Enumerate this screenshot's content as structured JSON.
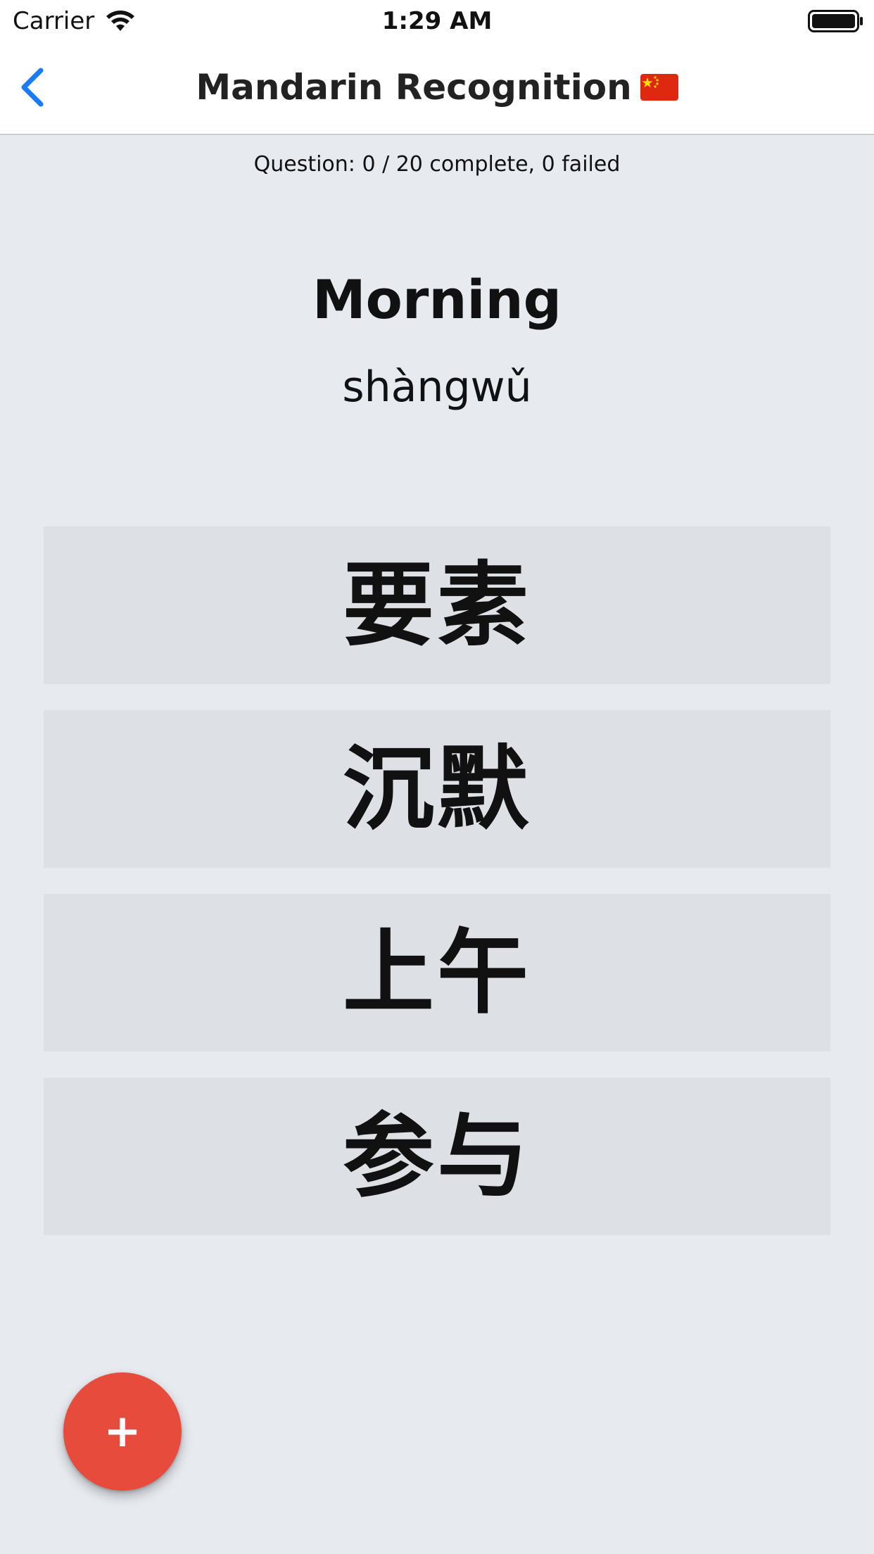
{
  "status_bar": {
    "carrier": "Carrier",
    "time": "1:29 AM",
    "wifi_icon": "wifi-icon",
    "battery_icon": "battery-full-icon"
  },
  "nav": {
    "back_icon": "chevron-left-icon",
    "title": "Mandarin Recognition",
    "flag_icon": "china-flag-icon",
    "accent_color": "#1a7cf5"
  },
  "quiz": {
    "progress": "Question: 0 / 20 complete, 0 failed",
    "prompt_word": "Morning",
    "prompt_pinyin": "shàngwǔ",
    "options": [
      {
        "label": "要素"
      },
      {
        "label": "沉默"
      },
      {
        "label": "上午"
      },
      {
        "label": "参与"
      }
    ]
  },
  "fab": {
    "icon": "plus-icon",
    "label": "+",
    "color": "#e64b3c"
  }
}
